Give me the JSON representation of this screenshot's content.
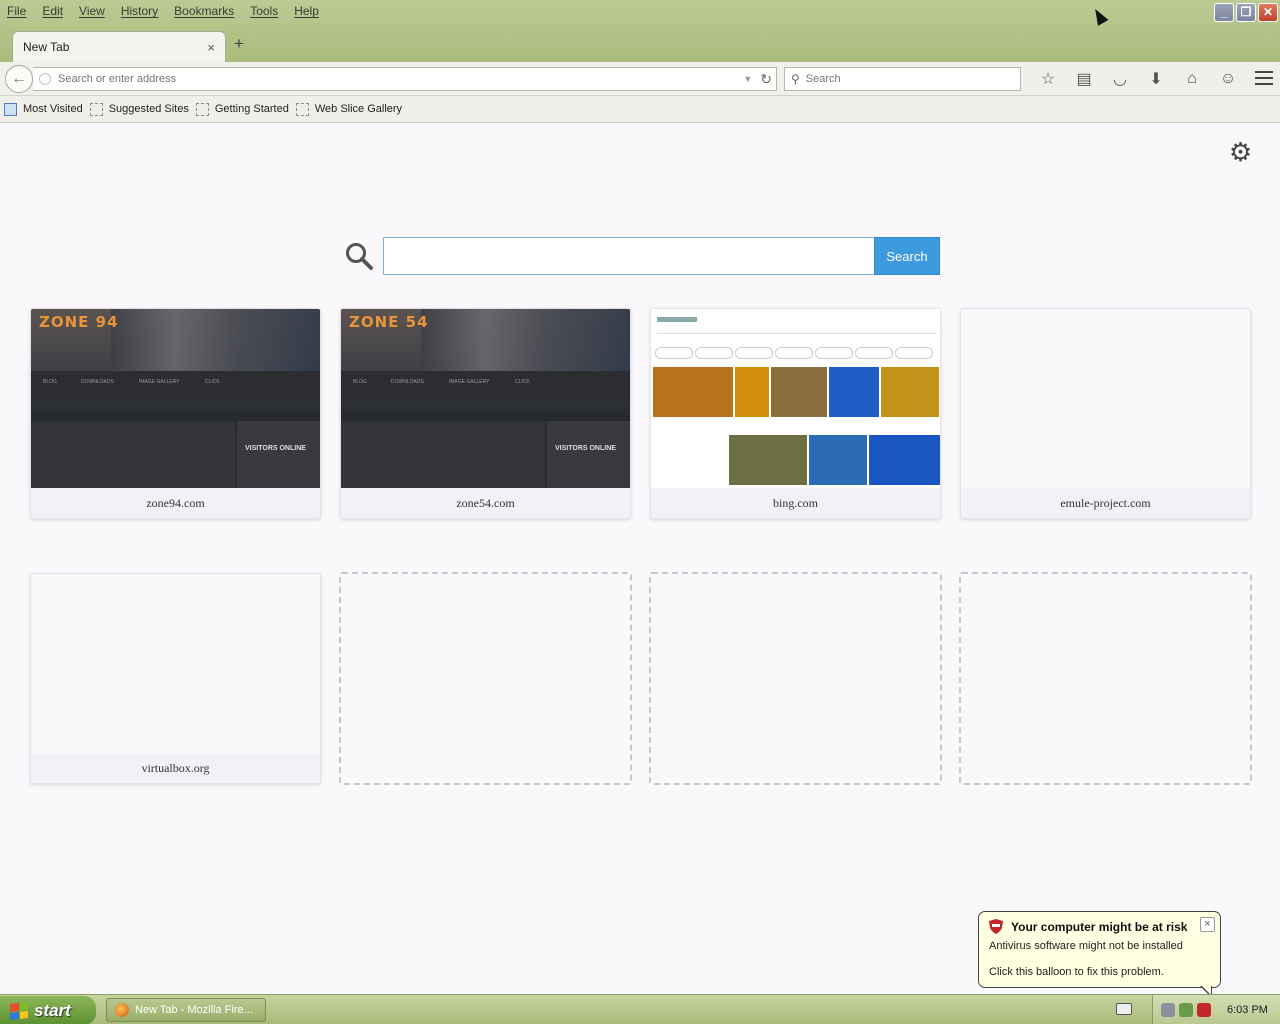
{
  "menubar": {
    "items": [
      "File",
      "Edit",
      "View",
      "History",
      "Bookmarks",
      "Tools",
      "Help"
    ]
  },
  "tab": {
    "label": "New Tab",
    "close": "×",
    "new_tab": "+"
  },
  "navbar": {
    "back": "←",
    "url_placeholder": "Search or enter address",
    "search_placeholder": "Search",
    "reload": "↻"
  },
  "bookmarks": [
    "Most Visited",
    "Suggested Sites",
    "Getting Started",
    "Web Slice Gallery"
  ],
  "ntp": {
    "search_button": "Search",
    "tiles": [
      {
        "title": "zone94.com",
        "logo": "ZONE 94",
        "nav": [
          "BLOG",
          "DOWNLOADS",
          "IMAGE GALLERY",
          "CLICK"
        ],
        "panel": "VISITORS ONLINE"
      },
      {
        "title": "zone54.com",
        "logo": "ZONE 54",
        "nav": [
          "BLOG",
          "DOWNLOADS",
          "IMAGE GALLERY",
          "CLICK"
        ],
        "panel": "VISITORS ONLINE"
      },
      {
        "title": "bing.com"
      },
      {
        "title": "emule-project.com"
      },
      {
        "title": "virtualbox.org"
      }
    ]
  },
  "balloon": {
    "title": "Your computer might be at risk",
    "line1": "Antivirus software might not be installed",
    "line2": "Click this balloon to fix this problem.",
    "close": "×"
  },
  "taskbar": {
    "start": "start",
    "task_label": "New Tab - Mozilla Fire...",
    "clock": "6:03 PM"
  },
  "colors": {
    "chrome": "#bccb94",
    "search_button": "#3e9ade",
    "balloon": "#ffffe1",
    "start": "#5c9230"
  }
}
